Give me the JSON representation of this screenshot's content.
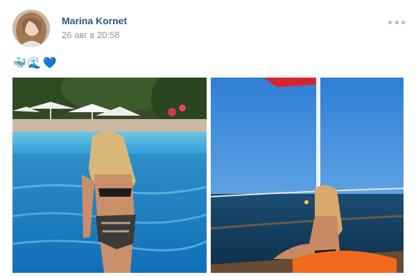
{
  "post": {
    "author_name": "Marina Kornet",
    "date": "26 авг в 20:58",
    "emojis": [
      {
        "char": "🐳",
        "name": "whale-emoji"
      },
      {
        "char": "🌊",
        "name": "wave-emoji"
      },
      {
        "char": "💙",
        "name": "blue-heart-emoji"
      }
    ],
    "more_icon": "more-horizontal-icon"
  },
  "colors": {
    "author_link": "#2a5885",
    "date_text": "#939393",
    "more_dots": "#b0b8c2"
  }
}
